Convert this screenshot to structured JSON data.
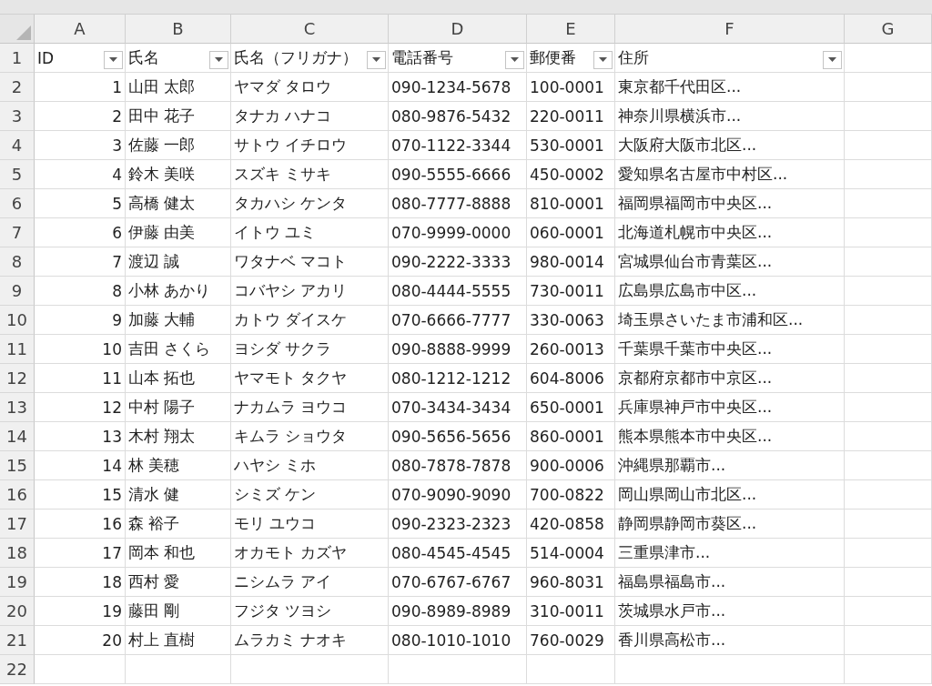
{
  "columns": [
    "A",
    "B",
    "C",
    "D",
    "E",
    "F",
    "G"
  ],
  "row_numbers": [
    "1",
    "2",
    "3",
    "4",
    "5",
    "6",
    "7",
    "8",
    "9",
    "10",
    "11",
    "12",
    "13",
    "14",
    "15",
    "16",
    "17",
    "18",
    "19",
    "20",
    "21",
    "22"
  ],
  "header": [
    {
      "label": "ID",
      "filter": true
    },
    {
      "label": "氏名",
      "filter": true
    },
    {
      "label": "氏名（フリガナ）",
      "filter": true
    },
    {
      "label": "電話番号",
      "filter": true
    },
    {
      "label": "郵便番",
      "filter": true
    },
    {
      "label": "住所",
      "filter": true
    }
  ],
  "rows": [
    {
      "id": "1",
      "name": "山田 太郎",
      "kana": "ヤマダ タロウ",
      "phone": "090-1234-5678",
      "zip": "100-0001",
      "address": "東京都千代田区..."
    },
    {
      "id": "2",
      "name": "田中 花子",
      "kana": "タナカ ハナコ",
      "phone": "080-9876-5432",
      "zip": "220-0011",
      "address": "神奈川県横浜市..."
    },
    {
      "id": "3",
      "name": "佐藤 一郎",
      "kana": "サトウ イチロウ",
      "phone": "070-1122-3344",
      "zip": "530-0001",
      "address": "大阪府大阪市北区..."
    },
    {
      "id": "4",
      "name": "鈴木 美咲",
      "kana": "スズキ ミサキ",
      "phone": "090-5555-6666",
      "zip": "450-0002",
      "address": "愛知県名古屋市中村区..."
    },
    {
      "id": "5",
      "name": "高橋 健太",
      "kana": "タカハシ ケンタ",
      "phone": "080-7777-8888",
      "zip": "810-0001",
      "address": "福岡県福岡市中央区..."
    },
    {
      "id": "6",
      "name": "伊藤 由美",
      "kana": "イトウ ユミ",
      "phone": "070-9999-0000",
      "zip": "060-0001",
      "address": "北海道札幌市中央区..."
    },
    {
      "id": "7",
      "name": "渡辺 誠",
      "kana": "ワタナベ マコト",
      "phone": "090-2222-3333",
      "zip": "980-0014",
      "address": "宮城県仙台市青葉区..."
    },
    {
      "id": "8",
      "name": "小林 あかり",
      "kana": "コバヤシ アカリ",
      "phone": "080-4444-5555",
      "zip": "730-0011",
      "address": "広島県広島市中区..."
    },
    {
      "id": "9",
      "name": "加藤 大輔",
      "kana": "カトウ ダイスケ",
      "phone": "070-6666-7777",
      "zip": "330-0063",
      "address": "埼玉県さいたま市浦和区..."
    },
    {
      "id": "10",
      "name": "吉田 さくら",
      "kana": "ヨシダ サクラ",
      "phone": "090-8888-9999",
      "zip": "260-0013",
      "address": "千葉県千葉市中央区..."
    },
    {
      "id": "11",
      "name": "山本 拓也",
      "kana": "ヤマモト タクヤ",
      "phone": "080-1212-1212",
      "zip": "604-8006",
      "address": "京都府京都市中京区..."
    },
    {
      "id": "12",
      "name": "中村 陽子",
      "kana": "ナカムラ ヨウコ",
      "phone": "070-3434-3434",
      "zip": "650-0001",
      "address": "兵庫県神戸市中央区..."
    },
    {
      "id": "13",
      "name": "木村 翔太",
      "kana": "キムラ ショウタ",
      "phone": "090-5656-5656",
      "zip": "860-0001",
      "address": "熊本県熊本市中央区..."
    },
    {
      "id": "14",
      "name": "林 美穂",
      "kana": "ハヤシ ミホ",
      "phone": "080-7878-7878",
      "zip": "900-0006",
      "address": "沖縄県那覇市..."
    },
    {
      "id": "15",
      "name": "清水 健",
      "kana": "シミズ ケン",
      "phone": "070-9090-9090",
      "zip": "700-0822",
      "address": "岡山県岡山市北区..."
    },
    {
      "id": "16",
      "name": "森 裕子",
      "kana": "モリ ユウコ",
      "phone": "090-2323-2323",
      "zip": "420-0858",
      "address": "静岡県静岡市葵区..."
    },
    {
      "id": "17",
      "name": "岡本 和也",
      "kana": "オカモト カズヤ",
      "phone": "080-4545-4545",
      "zip": "514-0004",
      "address": "三重県津市..."
    },
    {
      "id": "18",
      "name": "西村 愛",
      "kana": "ニシムラ アイ",
      "phone": "070-6767-6767",
      "zip": "960-8031",
      "address": "福島県福島市..."
    },
    {
      "id": "19",
      "name": "藤田 剛",
      "kana": "フジタ ツヨシ",
      "phone": "090-8989-8989",
      "zip": "310-0011",
      "address": "茨城県水戸市..."
    },
    {
      "id": "20",
      "name": "村上 直樹",
      "kana": "ムラカミ ナオキ",
      "phone": "080-1010-1010",
      "zip": "760-0029",
      "address": "香川県高松市..."
    }
  ]
}
